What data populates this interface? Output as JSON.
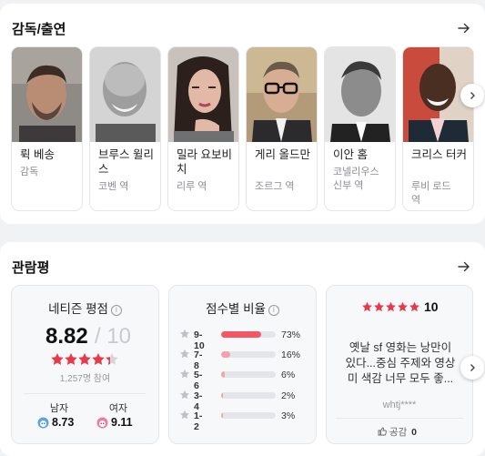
{
  "cast_section": {
    "title": "감독/출연",
    "people": [
      {
        "name": "뤽 베송",
        "role": "감독",
        "character": ""
      },
      {
        "name": "브루스 윌리스",
        "role": "코벤 역",
        "character": ""
      },
      {
        "name": "밀라 요보비치",
        "role": "리루 역",
        "character": ""
      },
      {
        "name": "게리 올드만",
        "role": "조르그 역",
        "character": ""
      },
      {
        "name": "이안 홈",
        "role": "코넬리우스",
        "character": "신부 역"
      },
      {
        "name": "크리스 터커",
        "role": "루비 로드",
        "character": "역"
      }
    ]
  },
  "review_section": {
    "title": "관람평",
    "netizen": {
      "title": "네티즌 평점",
      "score": "8.82",
      "max": "/ 10",
      "stars": 4.41,
      "participants": "1,257명 참여",
      "male_label": "남자",
      "male_score": "8.73",
      "female_label": "여자",
      "female_score": "9.11"
    },
    "distribution": {
      "title": "점수별 비율",
      "rows": [
        {
          "label": "9-10",
          "percent": 73,
          "text": "73%"
        },
        {
          "label": "7-8",
          "percent": 16,
          "text": "16%"
        },
        {
          "label": "5-6",
          "percent": 6,
          "text": "6%"
        },
        {
          "label": "3-4",
          "percent": 2,
          "text": "2%"
        },
        {
          "label": "1-2",
          "percent": 3,
          "text": "3%"
        }
      ]
    },
    "featured_review": {
      "score": "10",
      "stars": 5,
      "text_line1": "옛날 sf 영화는 낭만이",
      "text_line2": "있다...중심 주제와 영상",
      "text_line3": "미 색감 너무 모두 좋...",
      "user": "whtj****",
      "like_label": "공감",
      "like_count": "0"
    }
  },
  "colors": {
    "accent_red": "#f55564",
    "star_red": "#e8384b",
    "male_blue": "#5ba3e8",
    "female_pink": "#f07aa0"
  }
}
